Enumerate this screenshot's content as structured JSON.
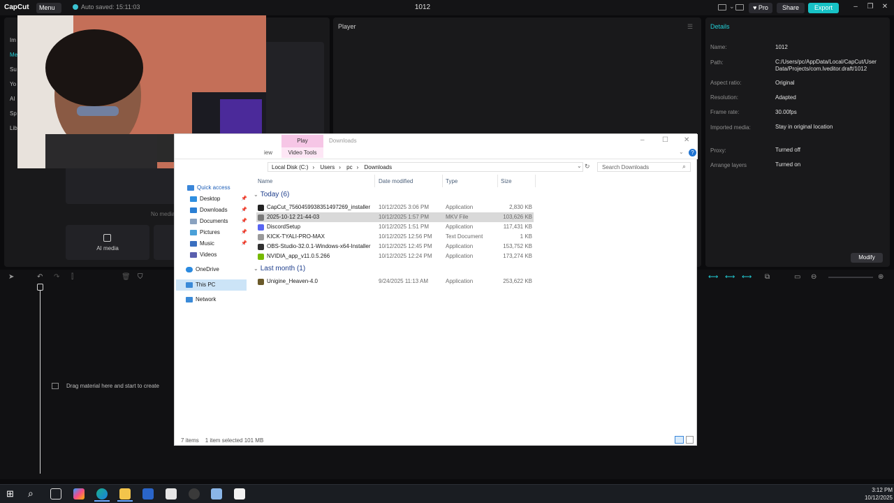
{
  "capcut": {
    "logo": "CapCut",
    "menu_label": "Menu ⌄",
    "autosave": "Auto saved: 15:11:03",
    "project_title": "1012",
    "pro_label": "♥ Pro",
    "share_label": "Share",
    "export_label": "Export",
    "accent_color": "#17c2c6",
    "sidebar_items": [
      "Im",
      "Me",
      "Su",
      "Yo",
      "AI",
      "Sp",
      "Lib"
    ],
    "media_empty": "No media",
    "ai_media_label": "AI media",
    "player_title": "Player",
    "details": {
      "title": "Details",
      "fields": [
        {
          "label": "Name:",
          "value": "1012"
        },
        {
          "label": "Path:",
          "value": "C:/Users/pc/AppData/Local/CapCut/User Data/Projects/com.lveditor.draft/1012"
        },
        {
          "label": "Aspect ratio:",
          "value": "Original"
        },
        {
          "label": "Resolution:",
          "value": "Adapted"
        },
        {
          "label": "Frame rate:",
          "value": "30.00fps"
        },
        {
          "label": "Imported media:",
          "value": "Stay in original location"
        },
        {
          "label": "Proxy:",
          "value": "Turned off"
        },
        {
          "label": "Arrange layers",
          "value": "Turned on"
        }
      ],
      "modify_label": "Modify"
    },
    "timeline_hint": "Drag material here and start to create"
  },
  "explorer": {
    "tab_play": "Play",
    "tab_video_tools": "Video Tools",
    "tab_view_partial": "iew",
    "title": "Downloads",
    "breadcrumb": [
      "Local Disk (C:)",
      "Users",
      "pc",
      "Downloads"
    ],
    "search_placeholder": "Search Downloads",
    "nav": {
      "quick_access": "Quick access",
      "items": [
        "Desktop",
        "Downloads",
        "Documents",
        "Pictures",
        "Music",
        "Videos"
      ],
      "onedrive": "OneDrive",
      "this_pc": "This PC",
      "network": "Network"
    },
    "columns": {
      "name": "Name",
      "date": "Date modified",
      "type": "Type",
      "size": "Size"
    },
    "group_today": "Today (6)",
    "group_last_month": "Last month (1)",
    "files_today": [
      {
        "name": "CapCut_7560459938351497269_installer",
        "date": "10/12/2025 3:06 PM",
        "type": "Application",
        "size": "2,830 KB",
        "color": "#222222"
      },
      {
        "name": "2025-10-12 21-44-03",
        "date": "10/12/2025 1:57 PM",
        "type": "MKV File",
        "size": "103,626 KB",
        "color": "#7a7a7a"
      },
      {
        "name": "DiscordSetup",
        "date": "10/12/2025 1:51 PM",
        "type": "Application",
        "size": "117,431 KB",
        "color": "#5865f2"
      },
      {
        "name": "KICK-TYALI-PRO-MAX",
        "date": "10/12/2025 12:56 PM",
        "type": "Text Document",
        "size": "1 KB",
        "color": "#9a9a9a"
      },
      {
        "name": "OBS-Studio-32.0.1-Windows-x64-Installer",
        "date": "10/12/2025 12:45 PM",
        "type": "Application",
        "size": "153,752 KB",
        "color": "#303030"
      },
      {
        "name": "NVIDIA_app_v11.0.5.266",
        "date": "10/12/2025 12:24 PM",
        "type": "Application",
        "size": "173,274 KB",
        "color": "#76b900"
      }
    ],
    "files_last_month": [
      {
        "name": "Unigine_Heaven-4.0",
        "date": "9/24/2025 11:13 AM",
        "type": "Application",
        "size": "253,622 KB",
        "color": "#6b5a2a"
      }
    ],
    "status_items": "7 items",
    "status_selected": "1 item selected  101 MB"
  },
  "taskbar": {
    "time": "3:12 PM",
    "date": "10/12/2025"
  }
}
